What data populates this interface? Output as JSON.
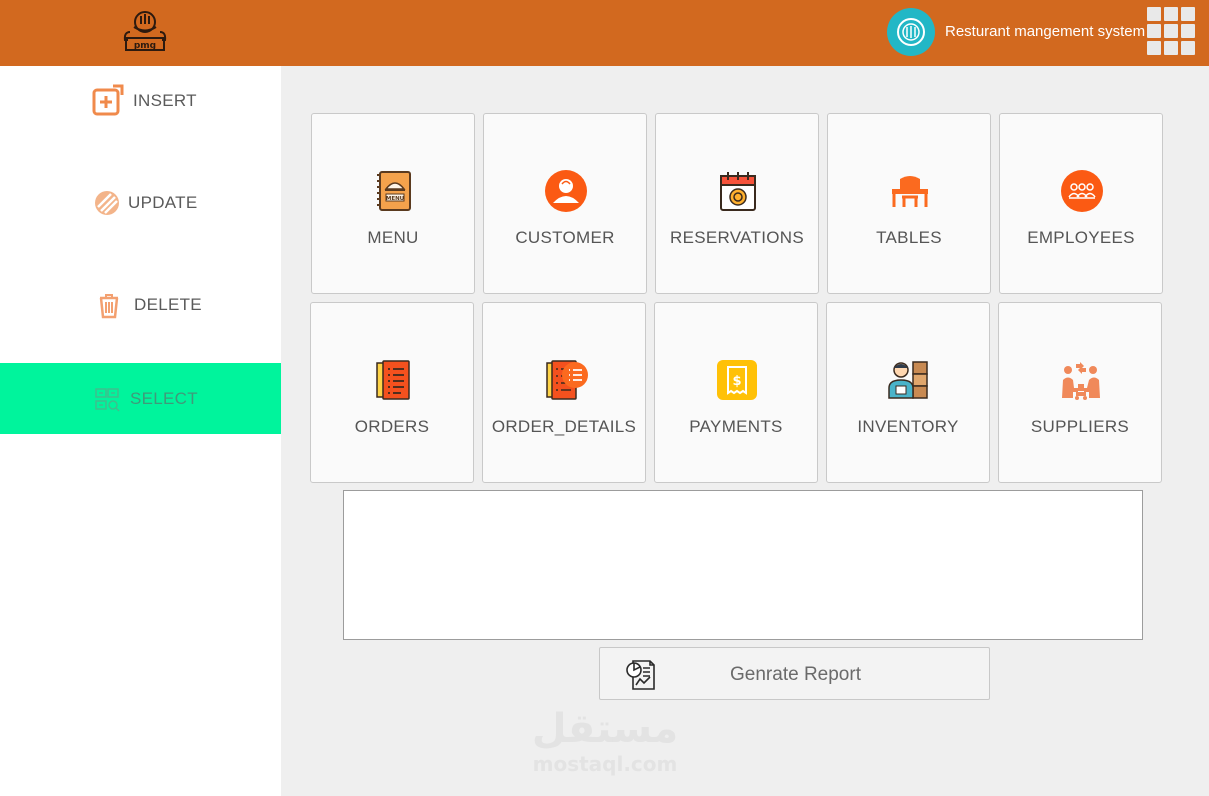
{
  "header": {
    "app_title": "Resturant mangement system",
    "logo_icon": "restaurant-logo-icon",
    "badge_icon": "restaurant-badge-icon",
    "apps_icon": "grid-apps-icon",
    "bar_color": "#d2691f"
  },
  "sidebar": {
    "items": [
      {
        "label": "INSERT",
        "icon": "add-square-icon",
        "active": false
      },
      {
        "label": "UPDATE",
        "icon": "update-stripes-icon",
        "active": false
      },
      {
        "label": "DELETE",
        "icon": "trash-icon",
        "active": false
      },
      {
        "label": "SELECT",
        "icon": "select-table-icon",
        "active": true
      }
    ],
    "active_color": "#00f49c"
  },
  "tables": [
    {
      "label": "MENU",
      "icon": "menu-book-icon"
    },
    {
      "label": "CUSTOMER",
      "icon": "customer-icon"
    },
    {
      "label": "RESERVATIONS",
      "icon": "calendar-icon"
    },
    {
      "label": "TABLES",
      "icon": "dining-table-icon"
    },
    {
      "label": "EMPLOYEES",
      "icon": "employees-icon"
    },
    {
      "label": "ORDERS",
      "icon": "orders-list-icon"
    },
    {
      "label": "ORDER_DETAILS",
      "icon": "order-details-icon"
    },
    {
      "label": "PAYMENTS",
      "icon": "payment-receipt-icon"
    },
    {
      "label": "INVENTORY",
      "icon": "inventory-worker-icon"
    },
    {
      "label": "SUPPLIERS",
      "icon": "suppliers-icon"
    }
  ],
  "report": {
    "button_label": "Genrate Report",
    "icon": "report-document-icon"
  },
  "watermark": {
    "arabic": "مستقل",
    "latin": "mostaql.com"
  }
}
